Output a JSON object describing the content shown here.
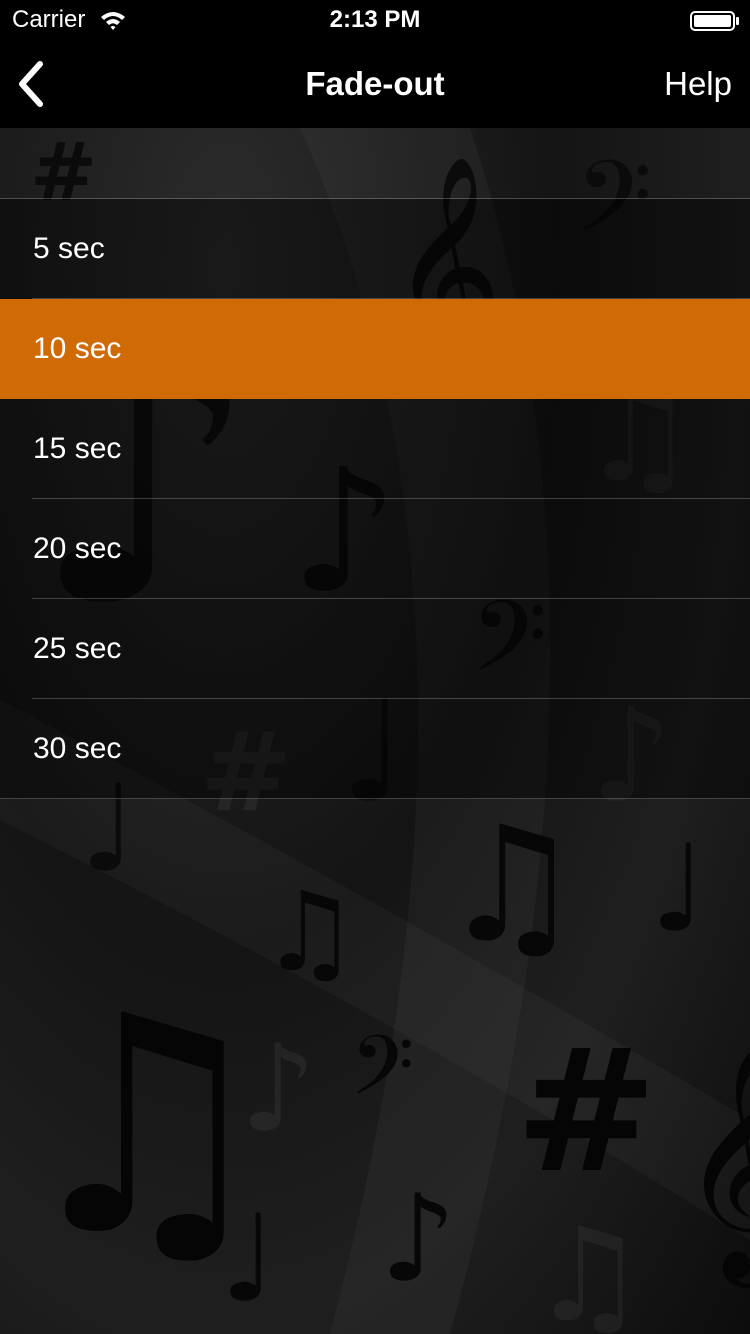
{
  "status_bar": {
    "carrier": "Carrier",
    "time": "2:13 PM",
    "icons": [
      "wifi-icon",
      "battery-icon"
    ]
  },
  "nav": {
    "back_icon": "chevron-left-icon",
    "title": "Fade-out",
    "help_label": "Help"
  },
  "fade_options": [
    {
      "label": "5 sec",
      "selected": false
    },
    {
      "label": "10 sec",
      "selected": true
    },
    {
      "label": "15 sec",
      "selected": false
    },
    {
      "label": "20 sec",
      "selected": false
    },
    {
      "label": "25 sec",
      "selected": false
    },
    {
      "label": "30 sec",
      "selected": false
    }
  ],
  "colors": {
    "selected_row": "#d06a04",
    "bars": "#000000",
    "text": "#ffffff"
  }
}
